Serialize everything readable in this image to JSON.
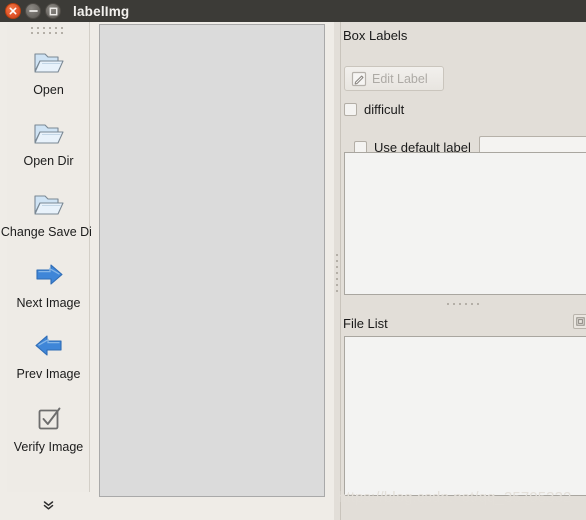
{
  "window": {
    "title": "labelImg",
    "controls": [
      {
        "name": "close",
        "glyph": "×"
      },
      {
        "name": "minimize",
        "glyph": "−"
      },
      {
        "name": "maximize",
        "glyph": "□"
      }
    ]
  },
  "toolbar": {
    "handle_name": "toolbar-drag-handle",
    "overflow_glyph": "⌄",
    "items": [
      {
        "label": "Open",
        "icon": "folder-open-icon"
      },
      {
        "label": "Open Dir",
        "icon": "folder-open-icon"
      },
      {
        "label": "Change Save Dir",
        "icon": "folder-open-icon"
      },
      {
        "label": "Next Image",
        "icon": "arrow-right-icon"
      },
      {
        "label": "Prev Image",
        "icon": "arrow-left-icon"
      },
      {
        "label": "Verify Image",
        "icon": "checkbox-checked-icon"
      }
    ]
  },
  "canvas": {
    "name": "image-canvas",
    "content": ""
  },
  "box_labels_panel": {
    "title": "Box Labels",
    "edit_label_button": {
      "label": "Edit Label",
      "icon": "edit-pencil-icon",
      "enabled": false
    },
    "difficult_checkbox": {
      "label": "difficult",
      "checked": false
    },
    "use_default_label_checkbox": {
      "label": "Use default label",
      "checked": false
    },
    "default_label_input": {
      "value": "",
      "placeholder": ""
    },
    "label_list": []
  },
  "file_list_panel": {
    "title": "File List",
    "float_button_icon": "dock-float-icon",
    "files": []
  },
  "watermark": {
    "text": "https://blog.csdn.net/qq_35705332"
  },
  "colors": {
    "titlebar": "#3c3b37",
    "window_bg": "#efece7",
    "dock_bg": "#e2ded8",
    "canvas_bg": "#dbdbdb",
    "listbox_bg": "#f3f3f2",
    "close_button": "#e2552a",
    "disabled_text": "#adaaa5",
    "folder_icon": "#b7d4ec",
    "arrow_icon": "#3b7fd4"
  }
}
